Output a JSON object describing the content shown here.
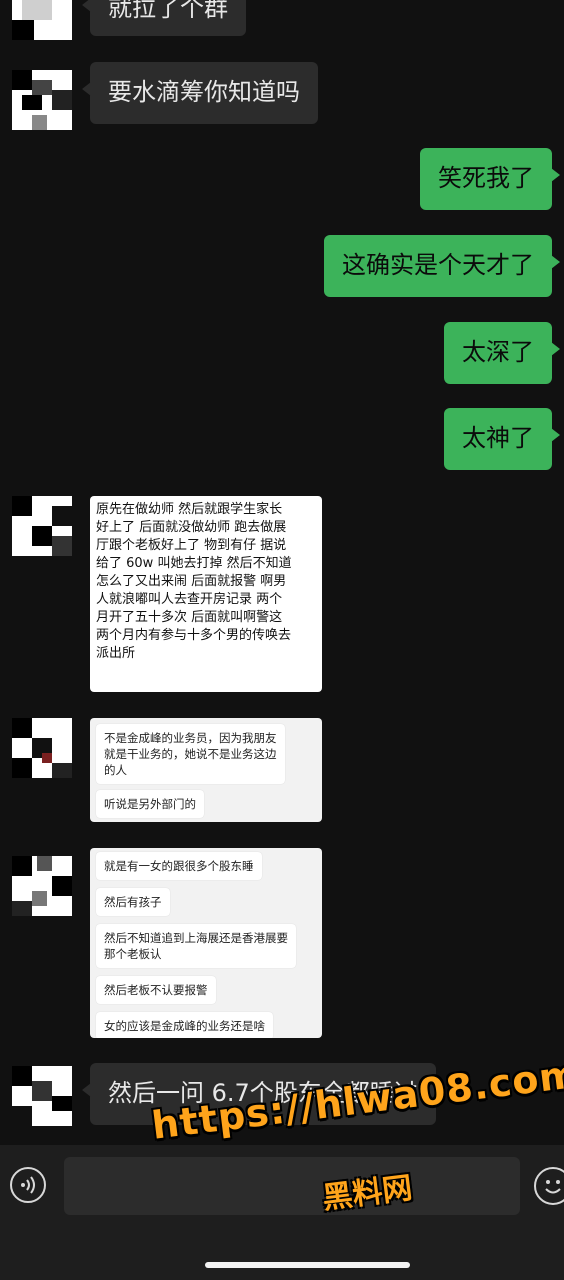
{
  "messages": {
    "top_partial": "就拉了个群",
    "m1": "要水滴筹你知道吗",
    "out1": "笑死我了",
    "out2": "这确实是个天才了",
    "out3": "太深了",
    "out4": "太神了",
    "last": "然后一问 6.7个股东全都睡过"
  },
  "screenshot1": {
    "text": "原先在做幼师 然后就跟学生家长\n好上了 后面就没做幼师 跑去做展\n厅跟个老板好上了 物到有仔 据说\n给了 60w 叫她去打掉 然后不知道\n怎么了又出来闹 后面就报警 啊男\n人就浪嘟叫人去查开房记录 两个\n月开了五十多次 后面就叫啊警这\n两个月内有参与十多个男的传唤去\n派出所"
  },
  "screenshot2": {
    "card1": "不是金成峰的业务员，因为我朋友\n就是干业务的，她说不是业务这边\n的人",
    "card2": "听说是另外部门的"
  },
  "screenshot3": {
    "cards": [
      "就是有一女的跟很多个股东睡",
      "然后有孩子",
      "然后不知道追到上海展还是香港展要\n那个老板认",
      "然后老板不认要报警",
      "女的应该是金成峰的业务还是啥"
    ]
  },
  "watermark": {
    "url": "https://hlwa08.com",
    "name": "黑料网"
  },
  "icons": {
    "voice": "voice-input-icon",
    "emoji": "emoji-icon"
  },
  "colors": {
    "outgoing_bubble": "#3cb35a",
    "incoming_bubble": "#2c2c2c",
    "background": "#111111",
    "watermark": "#ffa41b"
  }
}
